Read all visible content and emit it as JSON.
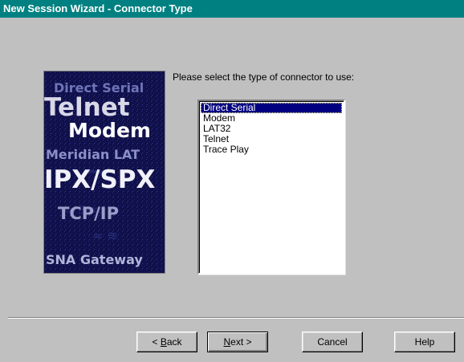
{
  "window": {
    "title": "New Session Wizard - Connector Type"
  },
  "banner": {
    "words": [
      "Direct Serial",
      "Telnet",
      "Modem",
      "Meridian LAT",
      "IPX/SPX",
      "TCP/IP",
      "SNA Gateway"
    ]
  },
  "prompt": "Please select the type of connector to use:",
  "connector_list": {
    "items": [
      "Direct Serial",
      "Modem",
      "LAT32",
      "Telnet",
      "Trace Play"
    ],
    "selected": "Direct Serial"
  },
  "buttons": {
    "back_mnemonic": "B",
    "back_rest": "ack",
    "back_prefix": "< ",
    "next_mnemonic": "N",
    "next_rest": "ext >",
    "cancel": "Cancel",
    "help": "Help"
  },
  "colors": {
    "titlebar": "#008080",
    "face": "#c0c0c0",
    "selection": "#000080",
    "banner_bg": "#10104a"
  }
}
